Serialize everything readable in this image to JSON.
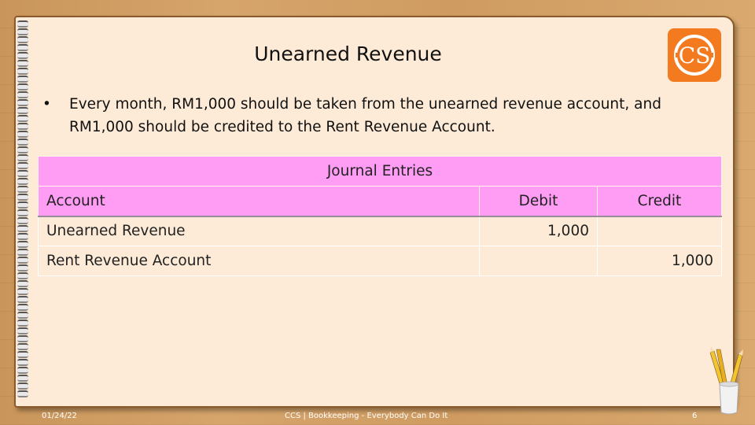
{
  "slide": {
    "title": "Unearned Revenue",
    "logo_text": "CS",
    "bullet_symbol": "•",
    "bullet_text": "Every month, RM1,000 should be taken from the unearned revenue account, and RM1,000 should be credited to the Rent Revenue Account."
  },
  "table": {
    "caption": "Journal Entries",
    "headers": [
      "Account",
      "Debit",
      "Credit"
    ],
    "rows": [
      [
        "Unearned Revenue",
        "1,000",
        ""
      ],
      [
        "Rent Revenue Account",
        "",
        "1,000"
      ]
    ]
  },
  "footer": {
    "date": "01/24/22",
    "center": "CCS | Bookkeeping - Everybody Can Do It",
    "page": "6"
  },
  "colors": {
    "header_fill": "#ff9cf4",
    "logo": "#f47a20",
    "paper": "#fdebd7"
  }
}
